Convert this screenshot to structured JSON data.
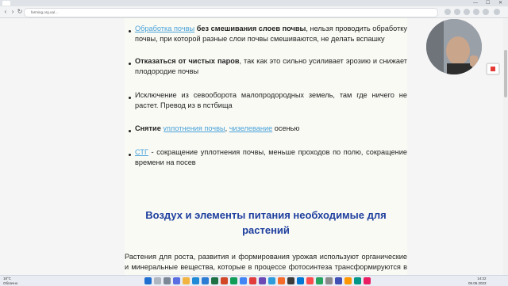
{
  "browser": {
    "url": "farming.org.ua/..."
  },
  "article": {
    "items": [
      {
        "link": "Обработка почвы",
        "bold": " без смешивания слоев почвы",
        "rest": ", нельзя проводить обработку почвы, при которой разные слои почвы смешиваются, не делать вспашку"
      },
      {
        "bold": "Отказаться от чистых паров",
        "rest": ", так как это сильно усиливает эрозию и снижает плодородие почвы"
      },
      {
        "rest": "Исключение из севооборота малопродородных земель, там где ничего не растет. Превод из в пстбища"
      },
      {
        "bold": "Снятие ",
        "link": "уплотнения почвы",
        "sep": ", ",
        "link2": "чизелевание",
        "rest": " осенью"
      },
      {
        "link": "СТГ",
        "rest": " - сокращение уплотнения почвы, меньше проходов по полю, сокращение времени на посев"
      }
    ],
    "heading": "Воздух и элементы питания необходимые для растений",
    "paragraph": "Растения для роста, развития и формирования урожая используют органические и минеральные вещества, которые в процессе фотосинтеза трансформируются в сложные органические соединения"
  },
  "taskbar": {
    "weather_temp": "18°C",
    "weather_desc": "Облачно",
    "time": "14:22",
    "date": "05.06.2023"
  }
}
